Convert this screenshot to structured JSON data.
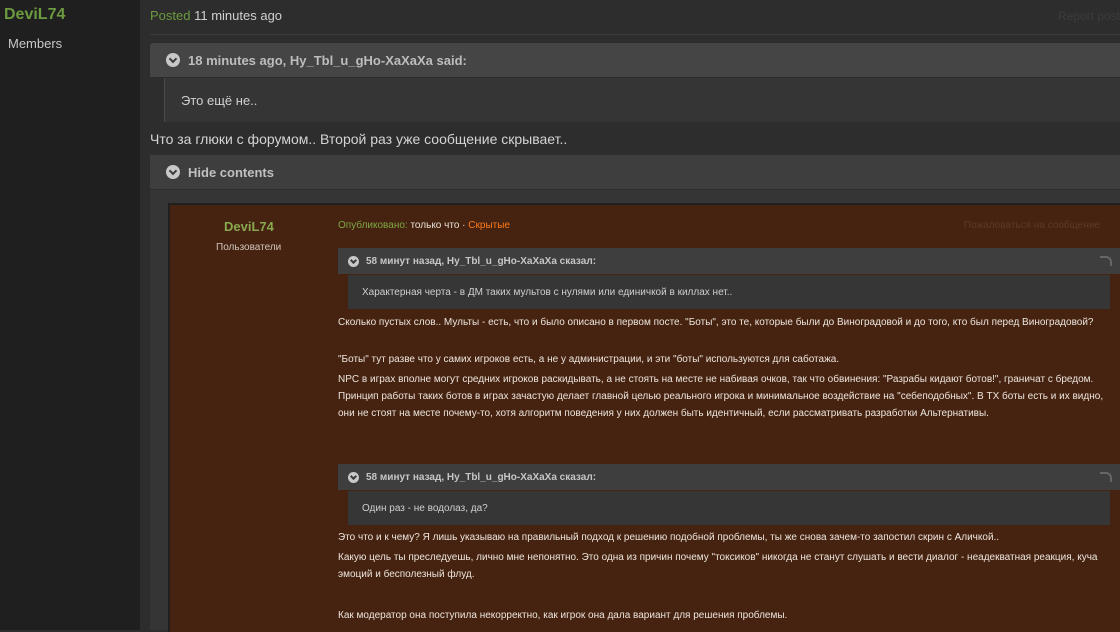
{
  "post_author": {
    "name": "DeviL74",
    "group": "Members"
  },
  "post_meta": {
    "posted_label": "Posted",
    "time": "11 minutes ago",
    "report": "Report post"
  },
  "quote": {
    "header": "18 minutes ago, Ну_Tbl_u_gHo-XaXaXa said:",
    "text": "Это ещё не.."
  },
  "post_text": "Что за глюки с форумом.. Второй раз уже сообщение скрывает..",
  "spoiler": {
    "label": "Hide contents"
  },
  "embedded": {
    "author": "DeviL74",
    "group": "Пользователи",
    "posted_label": "Опубликовано:",
    "time": "только что",
    "separator": "·",
    "hidden_label": "Скрытые",
    "report": "Пожаловаться на сообщение",
    "quote1": {
      "header": "58 минут назад, Ну_Tbl_u_gHo-XaXaXa сказал:",
      "text": "Характерная черта - в ДМ таких мультов с нулями или единичкой в киллах нет.."
    },
    "para1": "Сколько пустых слов.. Мульты - есть, что и было описано в первом посте. \"Боты\", это те, которые были до Виноградовой и до того, кто был перед Виноградовой?",
    "para2": "\"Боты\" тут разве что у самих игроков есть, а не у администрации, и эти \"боты\" используются для саботажа.",
    "para3": "NPC в играх вполне могут средних игроков раскидывать, а не стоять на месте не набивая очков, так что обвинения: \"Разрабы кидают ботов!\", граничат с бредом. Принцип работы таких ботов в играх зачастую делает главной целью реального игрока и минимальное воздействие на \"себеподобных\". В ТХ боты есть и их видно, они не стоят на месте почему-то, хотя алгоритм поведения у них должен быть идентичный, если рассматривать разработки Альтернативы.",
    "quote2": {
      "header": "58 минут назад, Ну_Tbl_u_gHo-XaXaXa сказал:",
      "text": "Один раз - не водолаз, да?"
    },
    "para4": "Это что и к чему? Я лишь указываю на правильный подход к решению подобной проблемы, ты же снова зачем-то запостил скрин с Аличкой..",
    "para5": "Какую цель ты преследуешь, лично мне непонятно. Это одна из причин почему \"токсиков\" никогда не станут слушать и вести диалог - неадекватная реакция, куча эмоций и бесполезный флуд.",
    "para6": "Как модератор она поступила некорректно, как игрок она дала вариант для решения проблемы."
  }
}
